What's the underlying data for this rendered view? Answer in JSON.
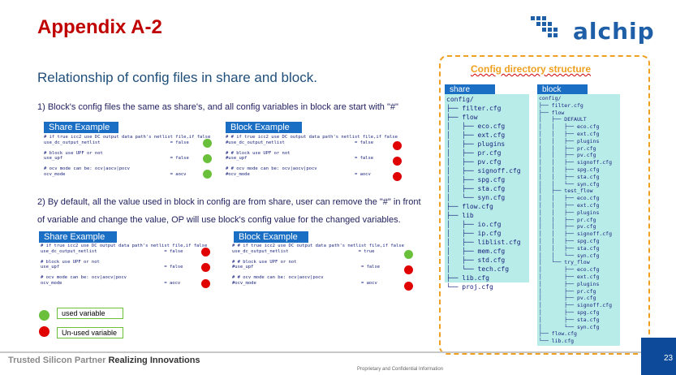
{
  "title": "Appendix A-2",
  "logo_text": "alchip",
  "subtitle": "Relationship of config files in share and block.",
  "item1": "1)     Block's config files the same as share's, and all config variables in block are start with \"#\"",
  "item2": "2)     By default, all the value used in block in config are from share, user can remove the \"#\" in front of variable and change the value, OP will use block's config value for the changed variables.",
  "example1": {
    "share_label": "Share Example",
    "share_code": "# if true icc2 use DC output data path's netlist file,if false\nuse_dc_output_netlist                          = false\n\n# block use UPF or not\nuse_upf                                        = false\n\n# ocv mode can be: ocv|aocv|pocv\nocv_mode                                       = aocv",
    "block_label": "Block Example",
    "block_code": "# # if true icc2 use DC output data path's netlist file,if false\n#use_dc_output_netlist                          = false\n\n# # block use UPF or not\n#use_upf                                        = false\n\n# # ocv mode can be: ocv|aocv|pocv\n#ocv_mode                                       = aocv"
  },
  "example2": {
    "share_label": "Share Example",
    "share_code": "# if true icc2 use DC output data path's netlist file,if false\nuse_dc_output_netlist                         = false\n\n# block use UPF or not\nuse_upf                                       = false\n\n# ocv mode can be: ocv|aocv|pocv\nocv_mode                                      = aocv",
    "block_label": "Block Example",
    "block_code": "# # if true icc2 use DC output data path's netlist file,if false\nuse_dc_output_netlist                          = true\n\n# # block use UPF or not\n#use_upf                                        = false\n\n# # ocv mode can be: ocv|aocv|pocv\n#ocv_mode                                       = aocv"
  },
  "legend": {
    "used": "used variable",
    "unused": "Un-used variable"
  },
  "dir_title": "Config directory structure",
  "share_tree": {
    "label": "share",
    "text": "config/\n├── filter.cfg\n├── flow\n│   ├── eco.cfg\n│   ├── ext.cfg\n│   ├── plugins\n│   ├── pr.cfg\n│   ├── pv.cfg\n│   ├── signoff.cfg\n│   ├── spg.cfg\n│   ├── sta.cfg\n│   └── syn.cfg\n├── flow.cfg\n├── lib\n│   ├── io.cfg\n│   ├── ip.cfg\n│   ├── liblist.cfg\n│   ├── mem.cfg\n│   ├── std.cfg\n│   └── tech.cfg\n├── lib.cfg\n└── proj.cfg"
  },
  "block_tree": {
    "label": "block",
    "text": "config/\n├── filter.cfg\n├── flow\n│   ├── DEFAULT\n│   │   ├── eco.cfg\n│   │   ├── ext.cfg\n│   │   ├── plugins\n│   │   ├── pr.cfg\n│   │   ├── pv.cfg\n│   │   ├── signoff.cfg\n│   │   ├── spg.cfg\n│   │   ├── sta.cfg\n│   │   └── syn.cfg\n│   ├── test_flow\n│   │   ├── eco.cfg\n│   │   ├── ext.cfg\n│   │   ├── plugins\n│   │   ├── pr.cfg\n│   │   ├── pv.cfg\n│   │   ├── signoff.cfg\n│   │   ├── spg.cfg\n│   │   ├── sta.cfg\n│   │   └── syn.cfg\n│   └── try_flow\n│       ├── eco.cfg\n│       ├── ext.cfg\n│       ├── plugins\n│       ├── pr.cfg\n│       ├── pv.cfg\n│       ├── signoff.cfg\n│       ├── spg.cfg\n│       ├── sta.cfg\n│       └── syn.cfg\n├── flow.cfg\n└── lib.cfg"
  },
  "footer": {
    "left": "Trusted Silicon Partner",
    "right": "Realizing Innovations",
    "page": "23",
    "confidential": "Proprietary and Confidential Information"
  },
  "colors": {
    "title": "#c00000",
    "label_blue": "#1a6fc4",
    "used_green": "#6abf3b",
    "unused_red": "#e00000",
    "accent_orange": "#f0a020",
    "tree_bg": "#b8ece9"
  }
}
